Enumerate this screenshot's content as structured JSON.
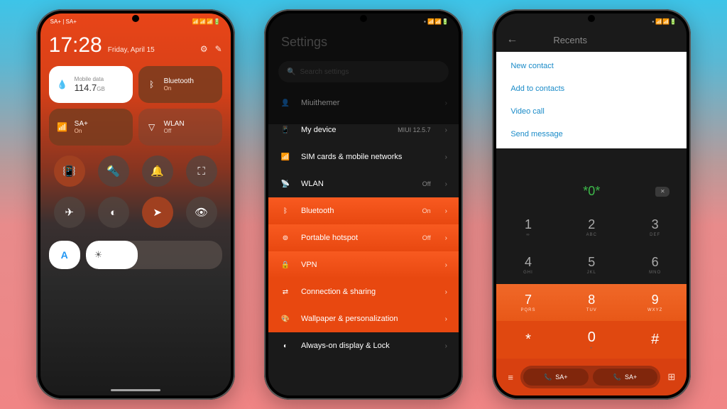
{
  "phone1": {
    "statusbar": {
      "left": "SA+ | SA+",
      "right": "📶📶📶🔋"
    },
    "time": "17:28",
    "date": "Friday, April 15",
    "tiles": {
      "data": {
        "label": "Mobile data",
        "value": "114.7",
        "unit": "GB"
      },
      "bt": {
        "label": "Bluetooth",
        "status": "On"
      },
      "sa": {
        "label": "SA+",
        "status": "On"
      },
      "wlan": {
        "label": "WLAN",
        "status": "Off"
      }
    },
    "autoLabel": "A"
  },
  "phone2": {
    "title": "Settings",
    "searchPlaceholder": "Search settings",
    "items": [
      {
        "icon": "👤",
        "label": "Miuithemer",
        "val": "",
        "cls": ""
      },
      {
        "icon": "📱",
        "label": "My device",
        "val": "MIUI 12.5.7",
        "cls": ""
      },
      {
        "icon": "📶",
        "label": "SIM cards & mobile networks",
        "val": "",
        "cls": ""
      },
      {
        "icon": "📡",
        "label": "WLAN",
        "val": "Off",
        "cls": ""
      },
      {
        "icon": "ᛒ",
        "label": "Bluetooth",
        "val": "On",
        "cls": "orange"
      },
      {
        "icon": "⊚",
        "label": "Portable hotspot",
        "val": "Off",
        "cls": "orange"
      },
      {
        "icon": "🔒",
        "label": "VPN",
        "val": "",
        "cls": "orange"
      },
      {
        "icon": "⇄",
        "label": "Connection & sharing",
        "val": "",
        "cls": "orange2"
      },
      {
        "icon": "🎨",
        "label": "Wallpaper & personalization",
        "val": "",
        "cls": "orange2"
      },
      {
        "icon": "◐",
        "label": "Always-on display & Lock",
        "val": "",
        "cls": ""
      }
    ]
  },
  "phone3": {
    "title": "Recents",
    "menu": [
      "New contact",
      "Add to contacts",
      "Video call",
      "Send message"
    ],
    "display": "*0*",
    "keys": [
      {
        "n": "1",
        "l": "∞",
        "cls": ""
      },
      {
        "n": "2",
        "l": "ABC",
        "cls": ""
      },
      {
        "n": "3",
        "l": "DEF",
        "cls": ""
      },
      {
        "n": "4",
        "l": "GHI",
        "cls": ""
      },
      {
        "n": "5",
        "l": "JKL",
        "cls": ""
      },
      {
        "n": "6",
        "l": "MNO",
        "cls": ""
      },
      {
        "n": "7",
        "l": "PQRS",
        "cls": "orange"
      },
      {
        "n": "8",
        "l": "TUV",
        "cls": "orange"
      },
      {
        "n": "9",
        "l": "WXYZ",
        "cls": "orange"
      },
      {
        "n": "*",
        "l": "",
        "cls": "orange2"
      },
      {
        "n": "0",
        "l": "+",
        "cls": "orange2"
      },
      {
        "n": "#",
        "l": "",
        "cls": "orange2"
      }
    ],
    "sim1": "SA+",
    "sim2": "SA+"
  }
}
